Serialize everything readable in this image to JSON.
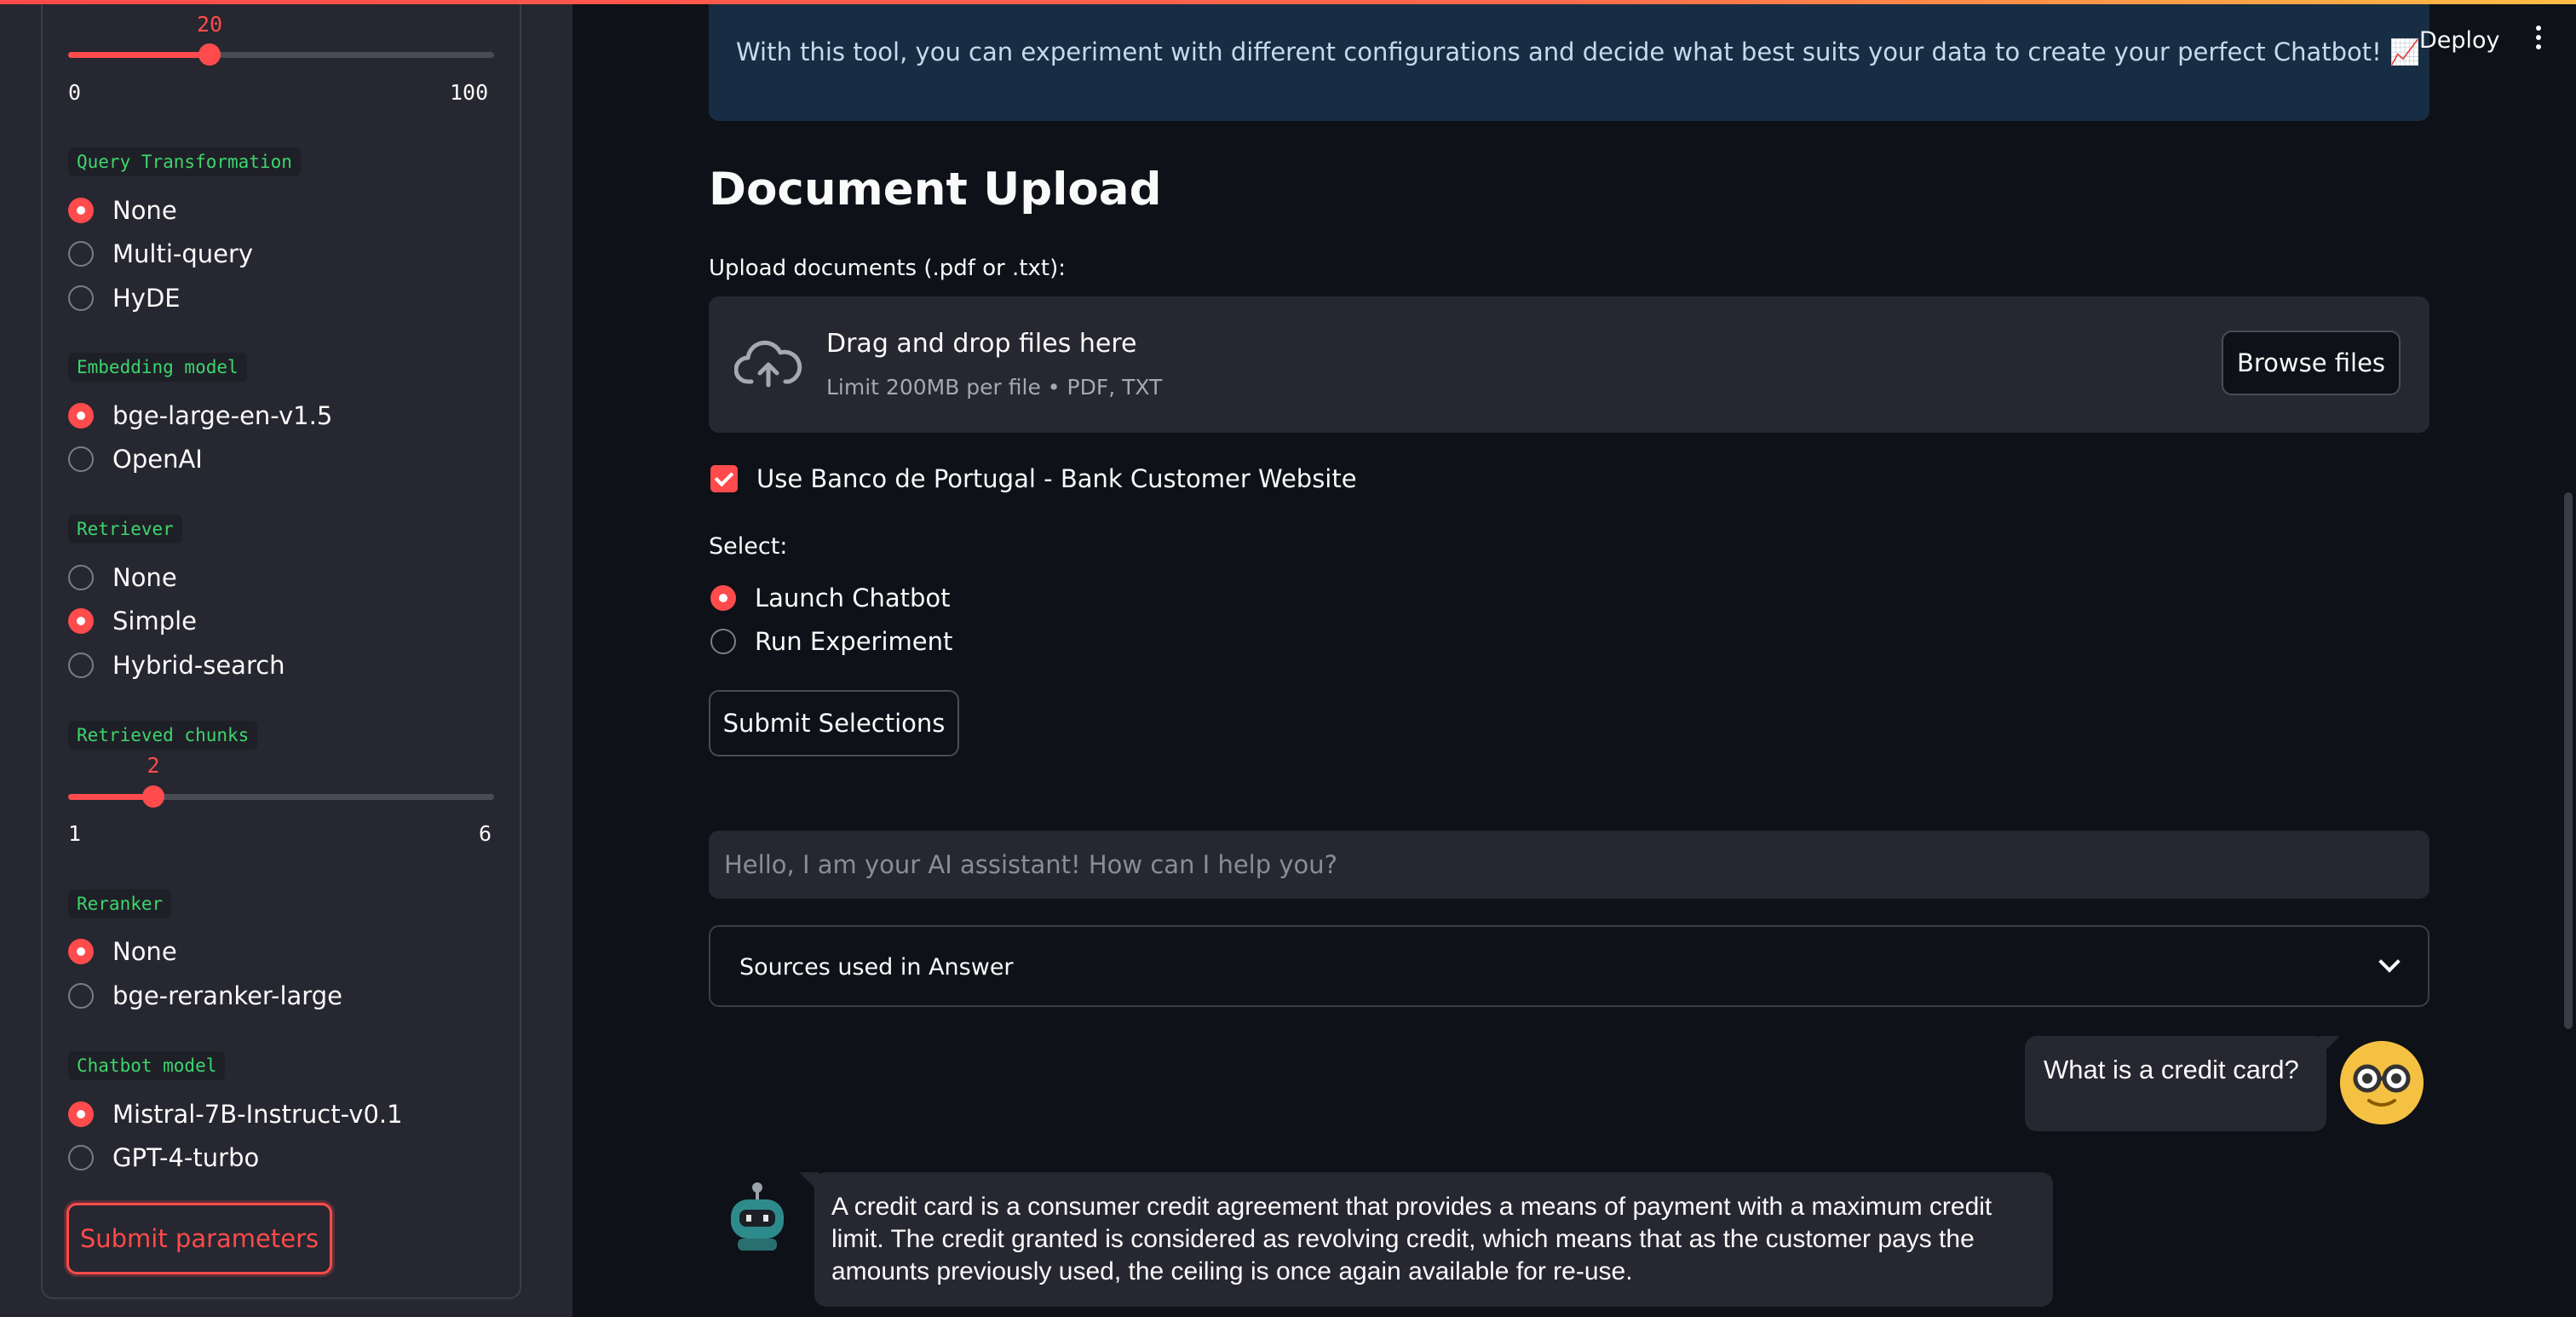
{
  "header": {
    "deploy_label": "Deploy"
  },
  "sidebar": {
    "top_slider": {
      "value": "20",
      "min": "0",
      "max": "100",
      "fraction": 0.2
    },
    "query_transformation": {
      "label": "Query Transformation",
      "options": [
        "None",
        "Multi-query",
        "HyDE"
      ],
      "selected": "None"
    },
    "embedding_model": {
      "label": "Embedding model",
      "options": [
        "bge-large-en-v1.5",
        "OpenAI"
      ],
      "selected": "bge-large-en-v1.5"
    },
    "retriever": {
      "label": "Retriever",
      "options": [
        "None",
        "Simple",
        "Hybrid-search"
      ],
      "selected": "Simple"
    },
    "retrieved_chunks": {
      "label": "Retrieved chunks",
      "value": "2",
      "min": "1",
      "max": "6",
      "fraction": 0.2
    },
    "reranker": {
      "label": "Reranker",
      "options": [
        "None",
        "bge-reranker-large"
      ],
      "selected": "None"
    },
    "chatbot_model": {
      "label": "Chatbot model",
      "options": [
        "Mistral-7B-Instruct-v0.1",
        "GPT-4-turbo"
      ],
      "selected": "Mistral-7B-Instruct-v0.1"
    },
    "submit_label": "Submit parameters"
  },
  "main": {
    "info_text": "With this tool, you can experiment with different configurations and decide what best suits your data to create your perfect Chatbot! 📈",
    "heading": "Document Upload",
    "upload_label": "Upload documents (.pdf or .txt):",
    "dropzone": {
      "title": "Drag and drop files here",
      "subtitle": "Limit 200MB per file • PDF, TXT",
      "browse_label": "Browse files"
    },
    "checkbox_label": "Use Banco de Portugal - Bank Customer Website",
    "checkbox_checked": true,
    "select": {
      "label": "Select:",
      "options": [
        "Launch Chatbot",
        "Run Experiment"
      ],
      "selected": "Launch Chatbot"
    },
    "submit_selections_label": "Submit Selections",
    "chat_placeholder": "Hello, I am your AI assistant! How can I help you?",
    "sources_label": "Sources used in Answer",
    "messages": {
      "user": "What is a credit card?",
      "assistant": "A credit card is a consumer credit agreement that provides a means of payment with a maximum credit limit. The credit granted is considered as revolving credit, which means that as the customer pays the amounts previously used, the ceiling is once again available for re-use."
    }
  },
  "colors": {
    "accent": "#ff4b4b",
    "background": "#0e1117",
    "panel": "#262730",
    "tag_text": "#3dd56d"
  },
  "icons": {
    "upload": "cloud-upload-icon",
    "menu": "kebab-menu-icon",
    "expand": "chevron-down-icon",
    "user_avatar": "nerd-face-icon",
    "bot_avatar": "robot-icon"
  }
}
